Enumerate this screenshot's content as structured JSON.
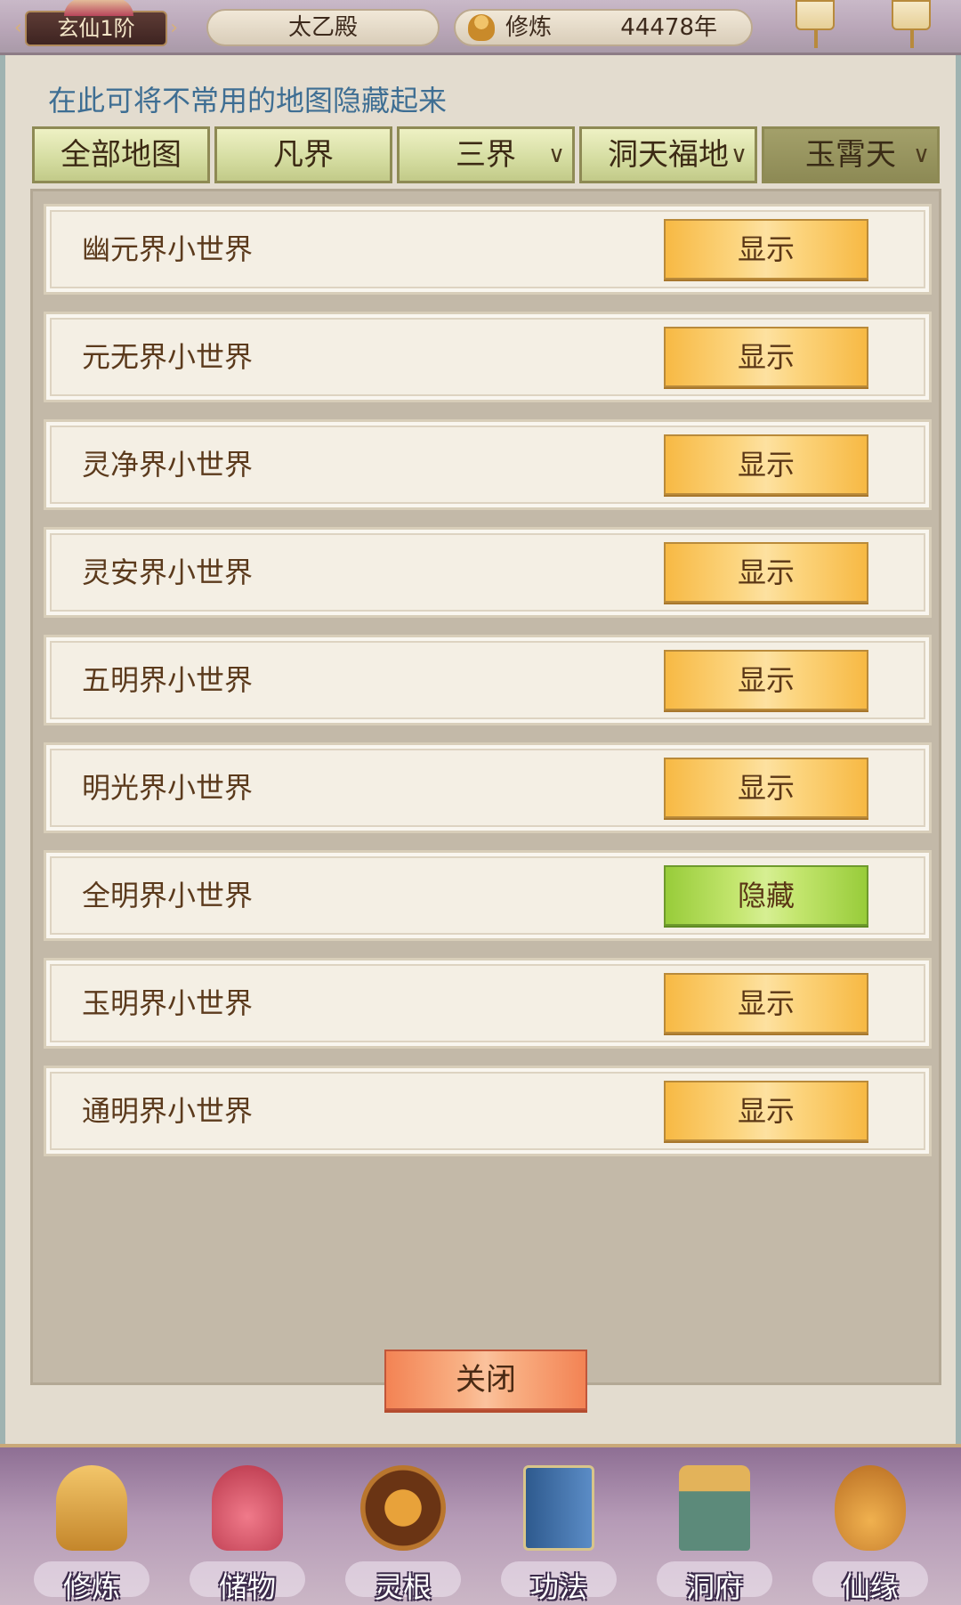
{
  "topbar": {
    "rank": "玄仙1阶",
    "location": "太乙殿",
    "cultivate_label": "修炼",
    "cultivate_value": "44478年"
  },
  "panel": {
    "hint": "在此可将不常用的地图隐藏起来",
    "tabs": [
      {
        "label": "全部地图",
        "has_dropdown": false,
        "active": false
      },
      {
        "label": "凡界",
        "has_dropdown": false,
        "active": false
      },
      {
        "label": "三界",
        "has_dropdown": true,
        "active": false
      },
      {
        "label": "洞天福地",
        "has_dropdown": true,
        "active": false
      },
      {
        "label": "玉霄天",
        "has_dropdown": true,
        "active": true
      }
    ],
    "caret": "∨",
    "rows": [
      {
        "name": "幽元界小世界",
        "action": "显示"
      },
      {
        "name": "元无界小世界",
        "action": "显示"
      },
      {
        "name": "灵净界小世界",
        "action": "显示"
      },
      {
        "name": "灵安界小世界",
        "action": "显示"
      },
      {
        "name": "五明界小世界",
        "action": "显示"
      },
      {
        "name": "明光界小世界",
        "action": "显示"
      },
      {
        "name": "全明界小世界",
        "action": "隐藏"
      },
      {
        "name": "玉明界小世界",
        "action": "显示"
      },
      {
        "name": "通明界小世界",
        "action": "显示"
      }
    ],
    "close_label": "关闭"
  },
  "nav": [
    {
      "label": "修炼",
      "icon": "cultivation-icon",
      "color": "#d8a03a"
    },
    {
      "label": "储物",
      "icon": "storage-bag-icon",
      "color": "#d9556a"
    },
    {
      "label": "灵根",
      "icon": "spirit-root-icon",
      "color": "#8a4a1e"
    },
    {
      "label": "功法",
      "icon": "scripture-book-icon",
      "color": "#3f6ea8"
    },
    {
      "label": "洞府",
      "icon": "cave-mansion-icon",
      "color": "#c78a3a"
    },
    {
      "label": "仙缘",
      "icon": "gourd-icon",
      "color": "#d4913a"
    }
  ],
  "colors": {
    "show_button": "#f7b944",
    "hide_button": "#98cc3a",
    "close_button": "#f38354",
    "hint_text": "#3e6e93"
  }
}
